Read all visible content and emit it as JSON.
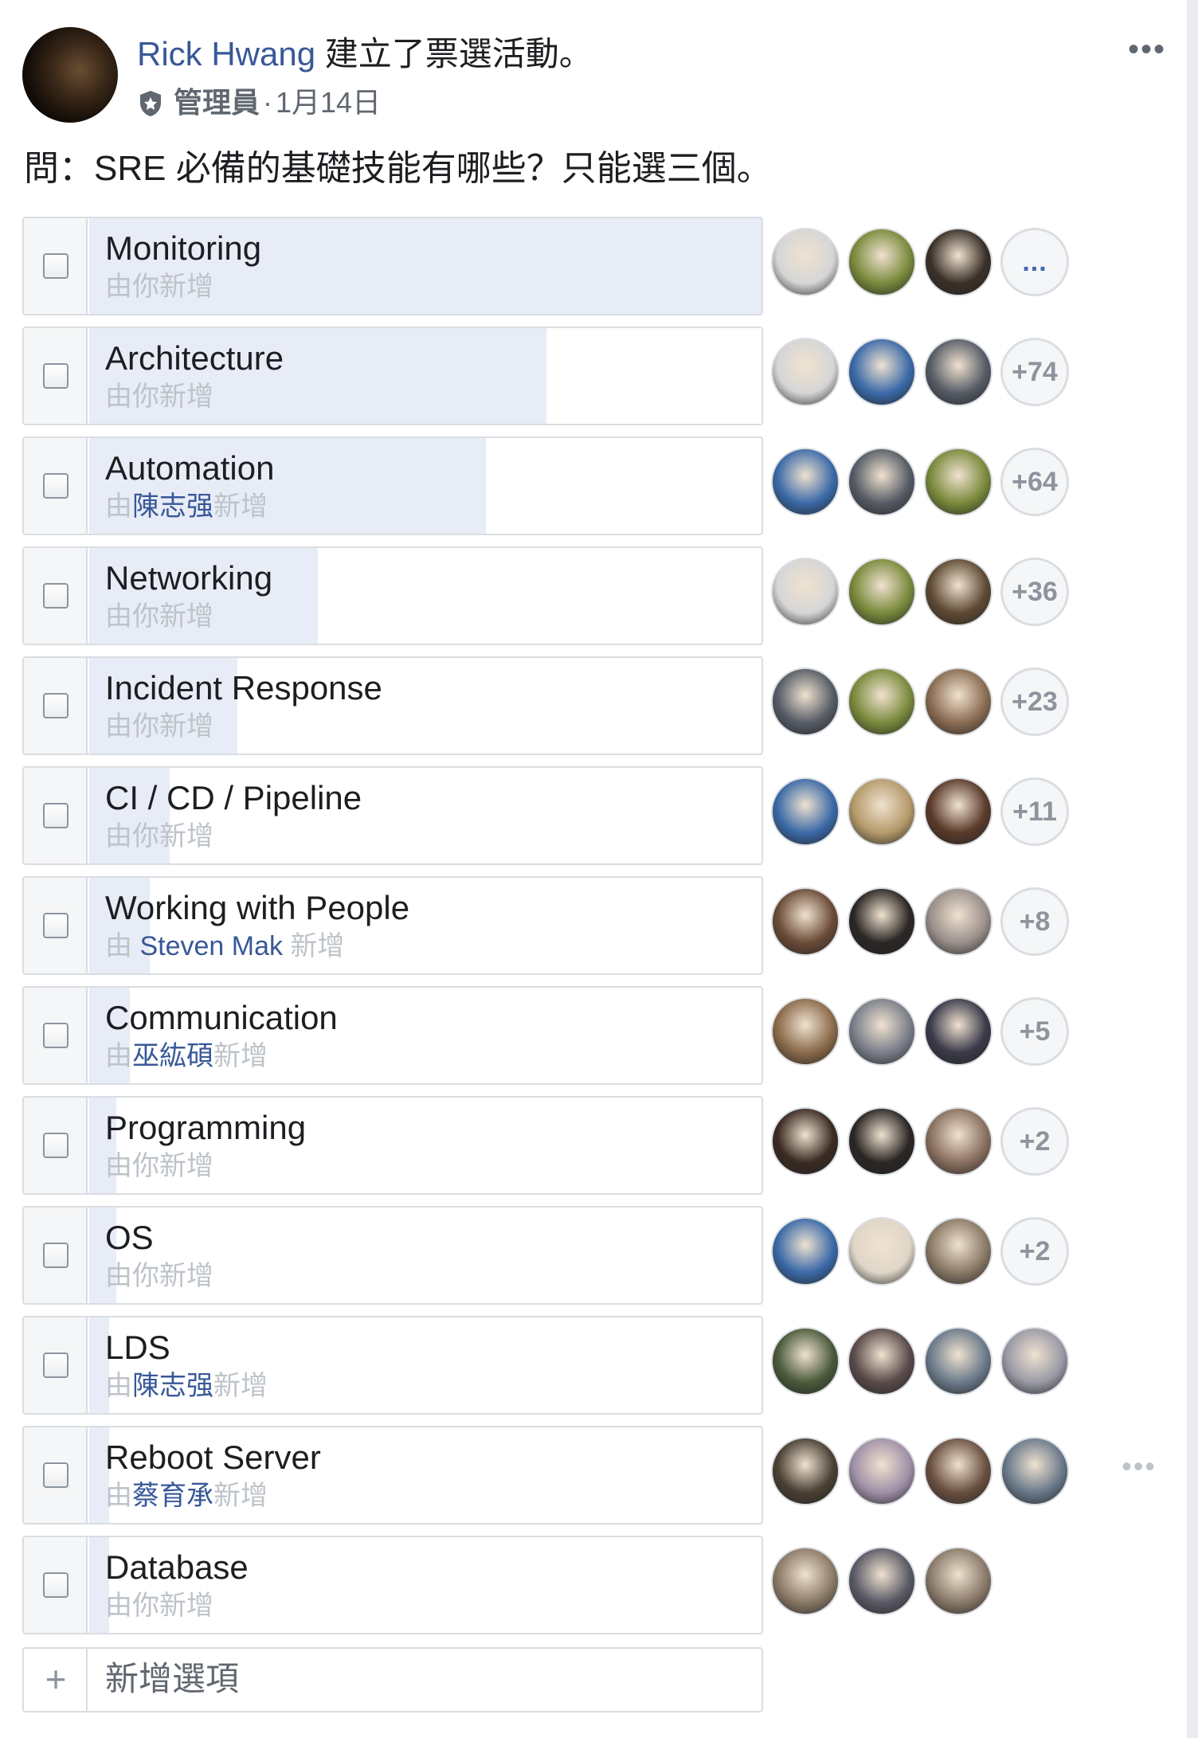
{
  "post": {
    "author": "Rick Hwang",
    "action": " 建立了票選活動。",
    "role": "管理員",
    "separator": " · ",
    "date": "1月14日",
    "more_icon": "more-horizontal-icon",
    "question": "問：SRE 必備的基礎技能有哪些？只能選三個。"
  },
  "colors": {
    "link": "#385898",
    "bar": "#e7ecf6",
    "border": "#dadde1",
    "muted": "#bec3c9"
  },
  "options": [
    {
      "label": "Monitoring",
      "by_prefix": "由你新增",
      "by_name": "",
      "by_suffix": "",
      "vote_fraction": 1.0,
      "voters": [
        "#d6d6d6",
        "#7a8a3c",
        "#3a3028"
      ],
      "more": "...",
      "more_blue": true
    },
    {
      "label": "Architecture",
      "by_prefix": "由你新增",
      "by_name": "",
      "by_suffix": "",
      "vote_fraction": 0.68,
      "voters": [
        "#d6d6d6",
        "#3b6aa8",
        "#565c66"
      ],
      "more": "+74"
    },
    {
      "label": "Automation",
      "by_prefix": "由",
      "by_name": "陳志强",
      "by_suffix": "新增",
      "vote_fraction": 0.59,
      "voters": [
        "#3b6aa8",
        "#565c66",
        "#7a8a3c"
      ],
      "more": "+64"
    },
    {
      "label": "Networking",
      "by_prefix": "由你新增",
      "by_name": "",
      "by_suffix": "",
      "vote_fraction": 0.34,
      "voters": [
        "#d6d6d6",
        "#7a8a3c",
        "#5e4a34"
      ],
      "more": "+36"
    },
    {
      "label": "Incident Response",
      "by_prefix": "由你新增",
      "by_name": "",
      "by_suffix": "",
      "vote_fraction": 0.22,
      "voters": [
        "#565c66",
        "#7a8a3c",
        "#8a6c52"
      ],
      "more": "+23"
    },
    {
      "label": "CI / CD / Pipeline",
      "by_prefix": "由你新增",
      "by_name": "",
      "by_suffix": "",
      "vote_fraction": 0.12,
      "voters": [
        "#3b6aa8",
        "#b59a6a",
        "#5a3a2a"
      ],
      "more": "+11"
    },
    {
      "label": "Working with People",
      "by_prefix": "由 ",
      "by_name": "Steven Mak",
      "by_suffix": " 新增",
      "vote_fraction": 0.09,
      "voters": [
        "#6a4b36",
        "#2a2624",
        "#9a8f8a"
      ],
      "more": "+8"
    },
    {
      "label": "Communication",
      "by_prefix": "由",
      "by_name": "巫紘碩",
      "by_suffix": "新增",
      "vote_fraction": 0.06,
      "voters": [
        "#8a6a4a",
        "#7a7f8a",
        "#3a3a4a"
      ],
      "more": "+5"
    },
    {
      "label": "Programming",
      "by_prefix": "由你新增",
      "by_name": "",
      "by_suffix": "",
      "vote_fraction": 0.04,
      "voters": [
        "#3a2a22",
        "#2a2624",
        "#8a7060"
      ],
      "more": "+2"
    },
    {
      "label": "OS",
      "by_prefix": "由你新增",
      "by_name": "",
      "by_suffix": "",
      "vote_fraction": 0.04,
      "voters": [
        "#3b6aa8",
        "#e0d6c8",
        "#8a7a66"
      ],
      "more": "+2"
    },
    {
      "label": "LDS",
      "by_prefix": "由",
      "by_name": "陳志强",
      "by_suffix": "新增",
      "vote_fraction": 0.03,
      "voters": [
        "#4a5a3a",
        "#5a4a4a",
        "#6a7a8a",
        "#9a9aa6"
      ],
      "more": ""
    },
    {
      "label": "Reboot Server",
      "by_prefix": "由",
      "by_name": "蔡育承",
      "by_suffix": "新增",
      "vote_fraction": 0.03,
      "voters": [
        "#4a4034",
        "#a090a8",
        "#6a5040",
        "#6a7a8a"
      ],
      "more": "",
      "row_more": "•••"
    },
    {
      "label": "Database",
      "by_prefix": "由你新增",
      "by_name": "",
      "by_suffix": "",
      "vote_fraction": 0.03,
      "voters": [
        "#8a7a66",
        "#5a5a66",
        "#8a7a6a"
      ],
      "more": ""
    }
  ],
  "add_option": {
    "placeholder": "新增選項",
    "plus": "+"
  }
}
